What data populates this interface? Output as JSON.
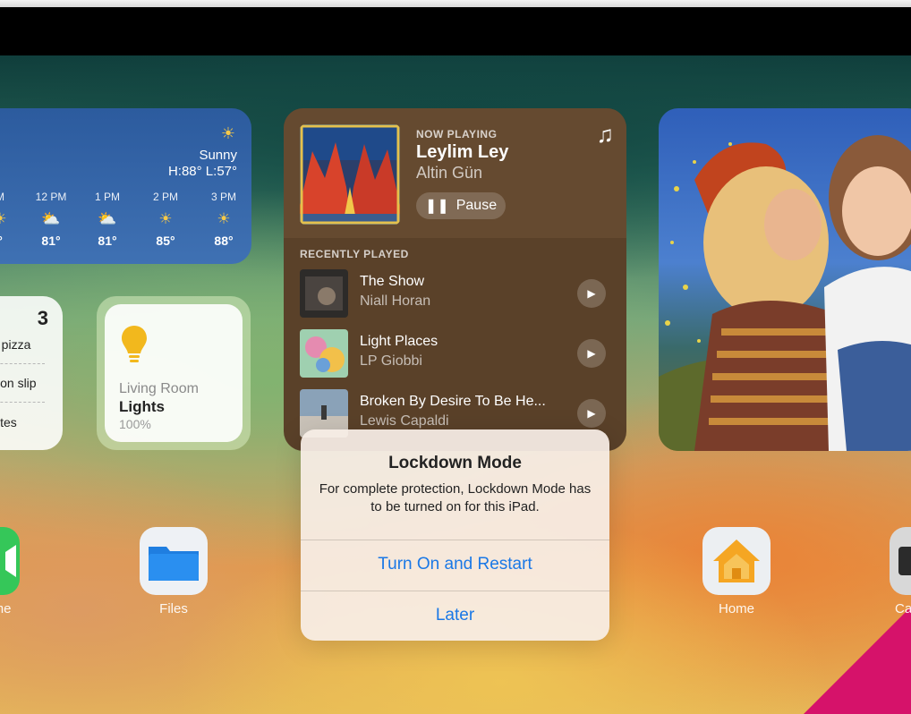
{
  "weather": {
    "condition": "Sunny",
    "high_low": "H:88° L:57°",
    "hours": [
      {
        "time": "M",
        "temp": "°",
        "icon": "sun-icon"
      },
      {
        "time": "12 PM",
        "temp": "81°",
        "icon": "partly-cloudy-icon"
      },
      {
        "time": "1 PM",
        "temp": "81°",
        "icon": "partly-cloudy-icon"
      },
      {
        "time": "2 PM",
        "temp": "85°",
        "icon": "sun-icon"
      },
      {
        "time": "3 PM",
        "temp": "88°",
        "icon": "sun-icon"
      }
    ]
  },
  "reminders": {
    "count": "3",
    "items": [
      "e pizza",
      "sion slip",
      "vites"
    ]
  },
  "lights": {
    "room": "Living Room",
    "name": "Lights",
    "level": "100%"
  },
  "music": {
    "now_playing_label": "NOW PLAYING",
    "title": "Leylim Ley",
    "artist": "Altin Gün",
    "pause_label": "Pause",
    "recently_played_label": "RECENTLY PLAYED",
    "tracks": [
      {
        "title": "The Show",
        "artist": "Niall Horan"
      },
      {
        "title": "Light Places",
        "artist": "LP Giobbi"
      },
      {
        "title": "Broken By Desire To Be He...",
        "artist": "Lewis Capaldi"
      }
    ]
  },
  "dock": {
    "facetime_label": "me",
    "files_label": "Files",
    "home_label": "Home",
    "camera_label": "Ca"
  },
  "alert": {
    "title": "Lockdown Mode",
    "message": "For complete protection, Lockdown Mode has to be turned on for this iPad.",
    "primary_button": "Turn On and Restart",
    "secondary_button": "Later"
  },
  "colors": {
    "accent": "#1a78e6",
    "weather_bg": "#3f71b3",
    "music_bg": "#5a4129",
    "magenta": "#d6126a"
  }
}
